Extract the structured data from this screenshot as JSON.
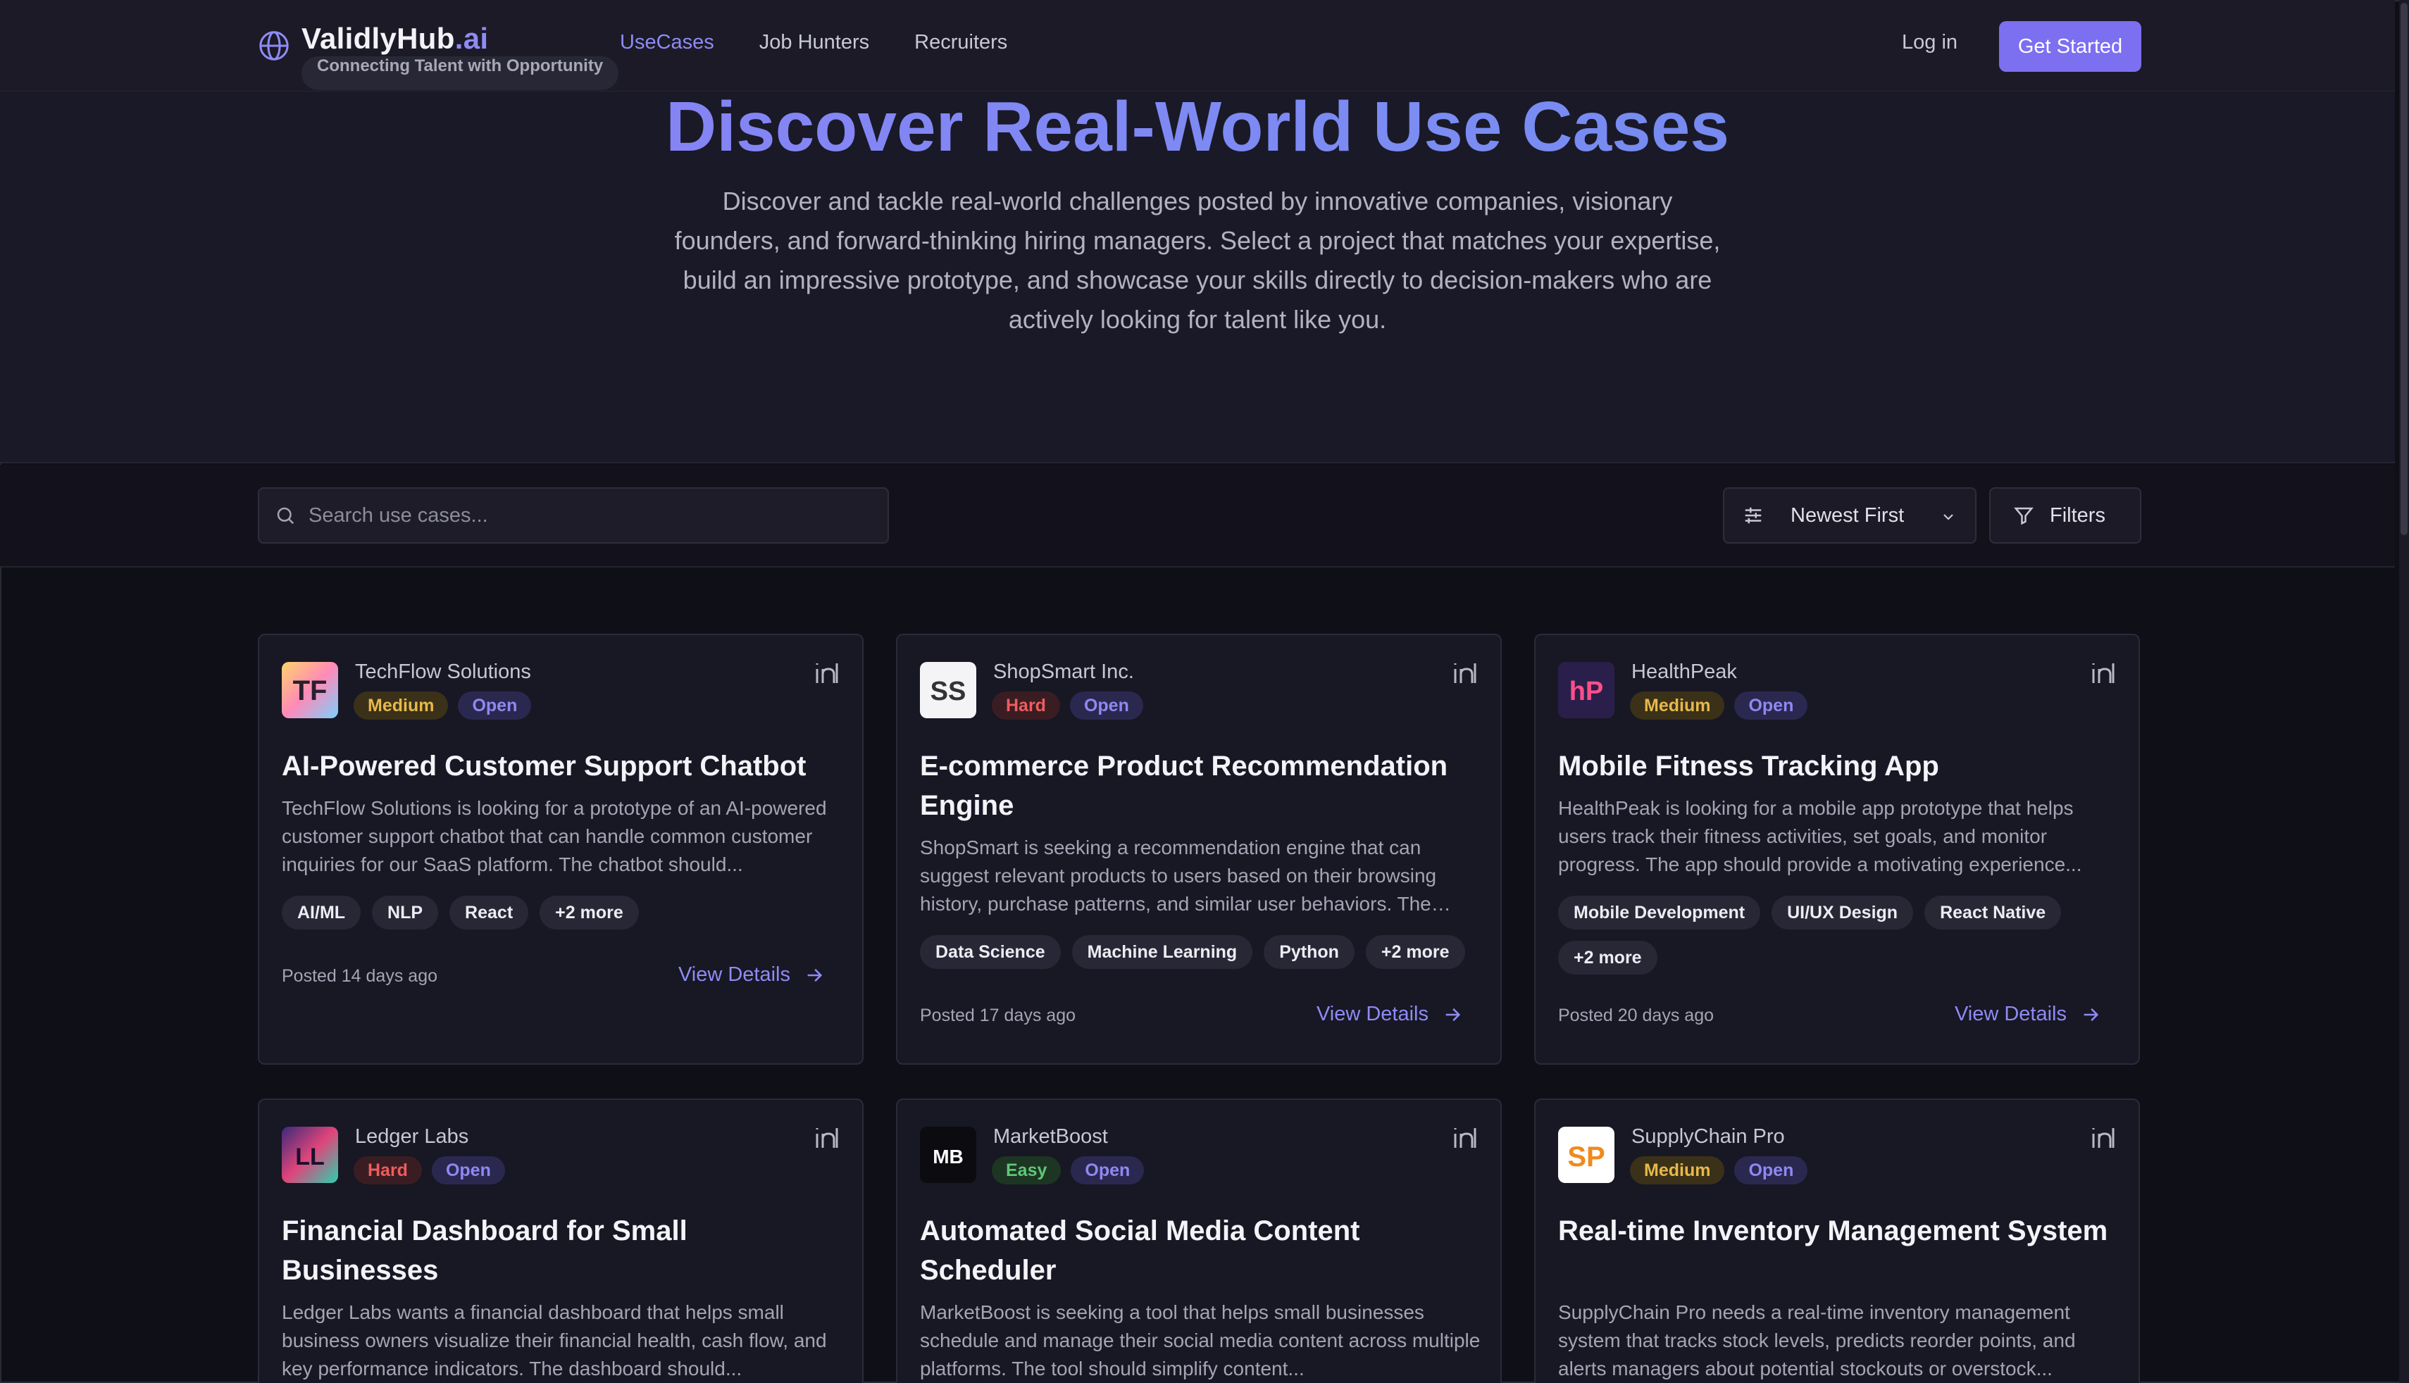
{
  "brand": {
    "name": "ValidlyHub",
    "suffix": ".ai",
    "tagline": "Connecting Talent with Opportunity"
  },
  "nav": {
    "items": [
      "UseCases",
      "Job Hunters",
      "Recruiters"
    ],
    "active": "UseCases"
  },
  "header": {
    "login": "Log in",
    "cta": "Get Started"
  },
  "hero": {
    "title": "Discover Real-World Use Cases",
    "subtitle": "Discover and tackle real-world challenges posted by innovative companies, visionary founders, and forward-thinking hiring managers. Select a project that matches your expertise, build an impressive prototype, and showcase your skills directly to decision-makers who are actively looking for talent like you."
  },
  "toolbar": {
    "search_placeholder": "Search use cases...",
    "sort_label": "Newest First",
    "filters_label": "Filters"
  },
  "colors": {
    "accent": "#7c6ff0",
    "medium": "#e7b84a",
    "hard": "#ee5d5d",
    "easy": "#5fc776",
    "open": "#8f88f2"
  },
  "cards": [
    {
      "company": "TechFlow Solutions",
      "logo": "TF",
      "difficulty": "Medium",
      "status": "Open",
      "title": "AI-Powered Customer Support Chatbot",
      "description": "TechFlow Solutions is looking for a prototype of an AI-powered customer support chatbot that can handle common customer inquiries for our SaaS platform. The chatbot should...",
      "tags": [
        "AI/ML",
        "NLP",
        "React",
        "+2 more"
      ],
      "posted": "Posted 14 days ago",
      "cta": "View Details"
    },
    {
      "company": "ShopSmart Inc.",
      "logo": "SS",
      "difficulty": "Hard",
      "status": "Open",
      "title": "E-commerce Product Recommendation Engine",
      "description": "ShopSmart is seeking a recommendation engine that can suggest relevant products to users based on their browsing history, purchase patterns, and similar user behaviors. The engine...",
      "tags": [
        "Data Science",
        "Machine Learning",
        "Python",
        "+2 more"
      ],
      "posted": "Posted 17 days ago",
      "cta": "View Details"
    },
    {
      "company": "HealthPeak",
      "logo": "hP",
      "difficulty": "Medium",
      "status": "Open",
      "title": "Mobile Fitness Tracking App",
      "description": "HealthPeak is looking for a mobile app prototype that helps users track their fitness activities, set goals, and monitor progress. The app should provide a motivating experience...",
      "tags": [
        "Mobile Development",
        "UI/UX Design",
        "React Native",
        "+2 more"
      ],
      "posted": "Posted 20 days ago",
      "cta": "View Details"
    },
    {
      "company": "Ledger Labs",
      "logo": "LL",
      "difficulty": "Hard",
      "status": "Open",
      "title": "Financial Dashboard for Small Businesses",
      "description": "Ledger Labs wants a financial dashboard that helps small business owners visualize their financial health, cash flow, and key performance indicators. The dashboard should...",
      "tags": [],
      "posted": "",
      "cta": ""
    },
    {
      "company": "MarketBoost",
      "logo": "MB",
      "difficulty": "Easy",
      "status": "Open",
      "title": "Automated Social Media Content Scheduler",
      "description": "MarketBoost is seeking a tool that helps small businesses schedule and manage their social media content across multiple platforms. The tool should simplify content...",
      "tags": [],
      "posted": "",
      "cta": ""
    },
    {
      "company": "SupplyChain Pro",
      "logo": "SP",
      "difficulty": "Medium",
      "status": "Open",
      "title": "Real-time Inventory Management System",
      "description": "SupplyChain Pro needs a real-time inventory management system that tracks stock levels, predicts reorder points, and alerts managers about potential stockouts or overstock...",
      "tags": [],
      "posted": "",
      "cta": ""
    }
  ]
}
